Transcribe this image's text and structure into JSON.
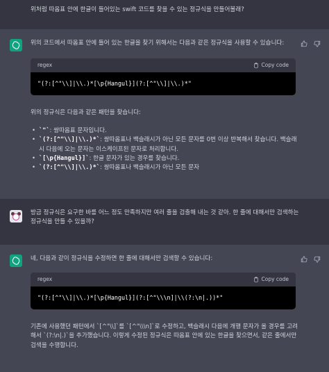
{
  "messages": {
    "user1": "위처럼 따옴표 안에 한글이 들어있는 swift 코드를 찾을 수 있는 정규식을 만들어볼래?",
    "assistant1": {
      "intro": "위의 코드에서 따옴표 안에 들어 있는 한글을 찾기 위해서는 다음과 같은 정규식을 사용할 수 있습니다:",
      "code_lang": "regex",
      "copy_label": "Copy code",
      "code": "\"(?:[^\"\\\\]|\\\\.)*[\\p{Hangul}](?:[^\"\\\\]|\\\\.)*\"",
      "explain_intro": "위의 정규식은 다음과 같은 패턴을 찾습니다:",
      "bullets": [
        {
          "code": "`\"`",
          "text": ": 쌍따옴표 문자입니다."
        },
        {
          "code": "`(?:[^\"\\\\]|\\\\.)*`",
          "text": ": 쌍따옴표나 백슬래시가 아닌 모든 문자를 0번 이상 반복해서 찾습니다. 백슬래시 다음에 오는 문자는 이스케이프된 문자로 처리합니다."
        },
        {
          "code": "`[\\p{Hangul}]`",
          "text": ": 한글 문자가 있는 경우를 찾습니다."
        },
        {
          "code": "`(?:[^\"\\\\]|\\\\.)*`",
          "text": ": 쌍따옴표나 백슬래시가 아닌 모든 문자"
        }
      ]
    },
    "user2": "방금 정규식은 요구한 바를 어느 정도 만족하지만 여러 줄을 검출해 내는 것 같아. 한 줄에 대해서만 검색하는 정규식을 만들 수 있을까?",
    "assistant2": {
      "intro": "네, 다음과 같이 정규식을 수정하면 한 줄에 대해서만 검색할 수 있습니다:",
      "code_lang": "regex",
      "copy_label": "Copy code",
      "code": "\"(?:[^\"\\\\]|\\\\.)*[\\p{Hangul}](?:[^\"\\\\\\n]|\\\\(?:\\n|.))*\"",
      "outro": "기존에 사용했던 패턴에서 `[^\"\\\\]`를 `[^\"\\\\\\n]`로 수정하고, 백슬래시 다음에 개행 문자가 올 경우를 고려해서 `(?:\\n|.)`을 추가했습니다. 이렇게 수정된 정규식은 따옴표 안에 있는 한글을 찾으면서, 같은 줄에서만 검색을 수행합니다."
    }
  },
  "colors": {
    "background": "#343541",
    "assistant_bg": "#444654",
    "accent": "#10a37f"
  }
}
